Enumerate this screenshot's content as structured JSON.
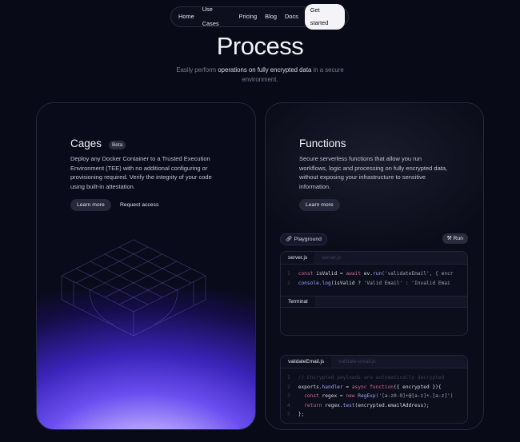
{
  "nav": {
    "items": [
      "Home",
      "Use Cases",
      "Pricing",
      "Blog",
      "Docs"
    ],
    "cta": "Get started"
  },
  "hero": {
    "title": "Process",
    "subtitle_pre": "Easily perform ",
    "subtitle_highlight": "operations on fully encrypted data",
    "subtitle_post": " in a secure environment."
  },
  "cages": {
    "title": "Cages",
    "badge": "Beta",
    "description": "Deploy any Docker Container to a Trusted Execution Environment (TEE) with no additional configuring or provisioning required. Verify the integrity of your code using built-in attestation.",
    "learn_more": "Learn more",
    "request_access": "Request access"
  },
  "functions": {
    "title": "Functions",
    "description": "Secure serverless functions that allow you run workflows, logic and processing on fully encrypted data, without exposing your infrastructure to sensitive information.",
    "learn_more": "Learn more"
  },
  "playground": {
    "label": "Playground",
    "run": "Run",
    "icons": {
      "playground": "link-icon",
      "run": "tools-icon"
    },
    "editor": {
      "tabs": [
        "server.js",
        "server.js"
      ],
      "lines": [
        {
          "n": "1",
          "code": "const isValid = await ev.run('validateEmail', { encr"
        },
        {
          "n": "2",
          "code": "console.log(isValid ? 'Valid Email' : 'Invalid Emai"
        }
      ]
    },
    "terminal": {
      "tab": "Terminal"
    },
    "fn_editor": {
      "tabs": [
        "validateEmail.js",
        "validate-email.js"
      ],
      "lines": [
        {
          "n": "1",
          "code": "// Encrypted payloads are automatically decrypted"
        },
        {
          "n": "2",
          "code": "exports.handler = async function({ encrypted }){"
        },
        {
          "n": "3",
          "code": "  const regex = new RegExp('[a-z0-9]+@[a-z]+.[a-z]')"
        },
        {
          "n": "4",
          "code": "  return regex.test(encrypted.emailAddress);"
        },
        {
          "n": "5",
          "code": "};"
        }
      ]
    }
  },
  "colors": {
    "background": "#080a17",
    "accent_purple": "#6a4ef0",
    "keyword": "#d26b92",
    "function": "#9aa6ff"
  }
}
